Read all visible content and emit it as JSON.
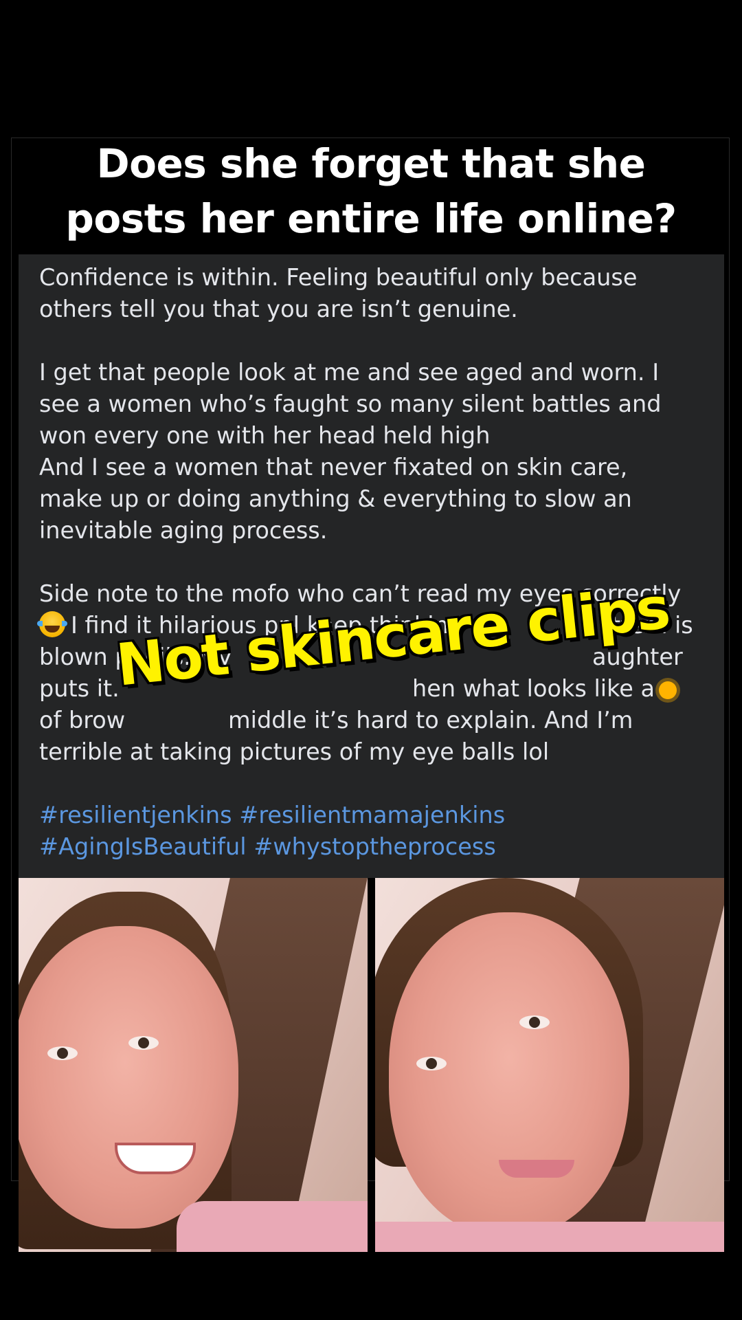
{
  "title": {
    "line1": "Does she forget that she",
    "line2": "posts her entire life online?"
  },
  "post": {
    "lines": [
      "Confidence is within. Feeling beautiful only because",
      "others tell you that you are isn’t genuine.",
      "I get that people look at me and see aged and worn. I",
      "see a women who’s faught so many silent battles and",
      "won every one with her head held high",
      "And I see a women that never fixated on skin care,",
      "make up or doing anything & everything to slow an",
      "inevitable aging process.",
      "Side note to the mofo who can’t read my eyes correctly",
      "I find it hilarious ppl keep thinking",
      "ttern is",
      "blown pupils. My",
      "aughter",
      "puts it.",
      "hen what looks like a",
      "of brow",
      "middle it’s hard to explain. And I’m",
      "terrible at taking pictures of my eye balls lol"
    ],
    "hashtags": [
      "#resilientjenkins",
      "#resilientmamajenkins",
      "#AgingIsBeautiful",
      "#whystoptheprocess"
    ]
  },
  "overlay_caption": "Not skincare clips",
  "icons": {
    "laugh": "laughing-crying-emoji-icon",
    "sun": "sun-emoji-icon"
  },
  "colors": {
    "background": "#000000",
    "card": "#242526",
    "text": "#e4e6eb",
    "hashtag": "#5b97e0",
    "caption": "#fff200"
  }
}
